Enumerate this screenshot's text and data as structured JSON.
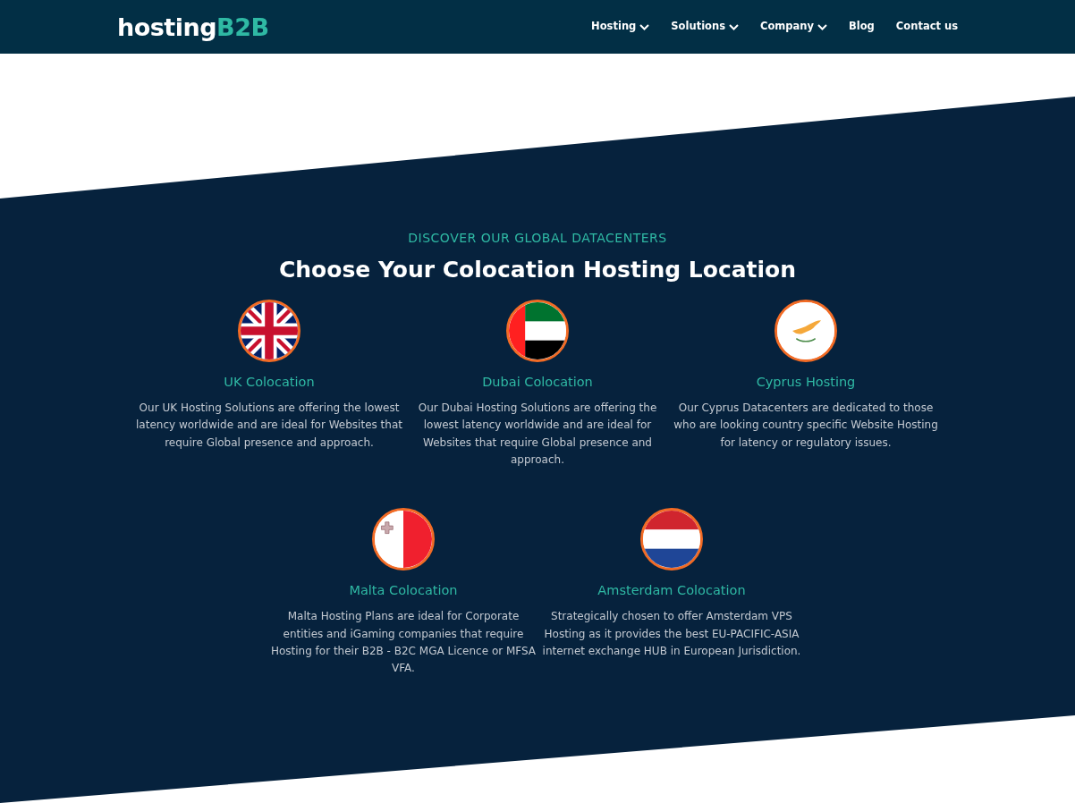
{
  "header": {
    "logo": {
      "main": "hosting",
      "accent": "B2B"
    },
    "nav": [
      {
        "label": "Hosting",
        "dropdown": true
      },
      {
        "label": "Solutions",
        "dropdown": true
      },
      {
        "label": "Company",
        "dropdown": true
      },
      {
        "label": "Blog",
        "dropdown": false
      },
      {
        "label": "Contact us",
        "dropdown": false
      }
    ]
  },
  "section": {
    "eyebrow": "DISCOVER OUR GLOBAL DATACENTERS",
    "heading": "Choose Your Colocation Hosting Location",
    "locations": [
      {
        "kind": "uk",
        "title": "UK Colocation",
        "text": "Our UK Hosting Solutions are offering the lowest latency worldwide and are ideal for Websites that require Global presence and approach."
      },
      {
        "kind": "uae",
        "title": "Dubai Colocation",
        "text": "Our Dubai Hosting Solutions are offering the lowest latency worldwide and are ideal for Websites that require Global presence and approach."
      },
      {
        "kind": "cyprus",
        "title": "Cyprus Hosting",
        "text": "Our Cyprus Datacenters are dedicated to those who are looking country specific Website Hosting for latency or regulatory issues."
      },
      {
        "kind": "malta",
        "title": "Malta Colocation",
        "text": "Malta Hosting Plans are ideal for Corporate entities and iGaming companies that require Hosting for their B2B - B2C MGA Licence or MFSA VFA."
      },
      {
        "kind": "netherlands",
        "title": "Amsterdam Colocation",
        "text": "Strategically chosen to offer Amsterdam VPS Hosting as it provides the best EU-PACIFIC-ASIA internet exchange HUB in European Jurisdiction."
      }
    ]
  }
}
